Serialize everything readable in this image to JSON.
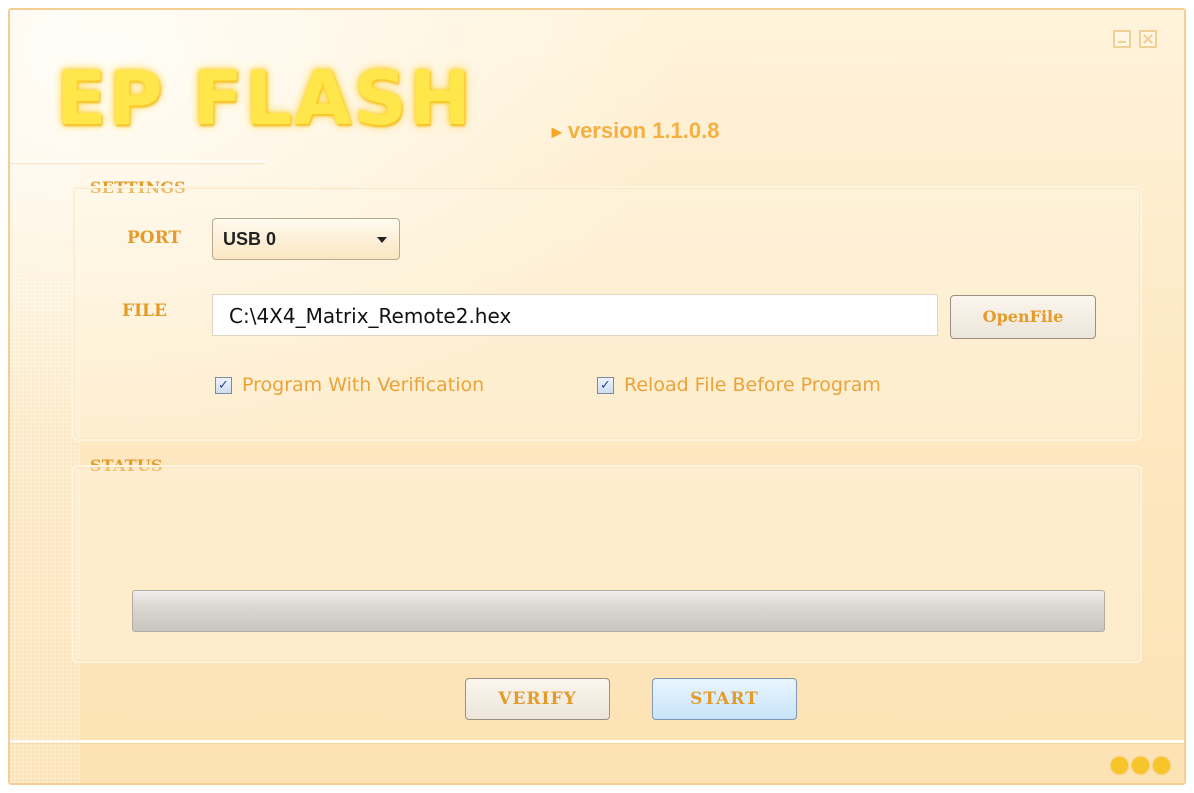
{
  "app": {
    "title": "EP FLASH",
    "version": "version 1.1.0.8",
    "version_arrow": "►"
  },
  "window_controls": {
    "minimize_icon": "minimize-icon",
    "close_icon": "close-icon"
  },
  "settings": {
    "label": "SETTINGS",
    "port": {
      "label": "PORT",
      "value": "USB 0"
    },
    "file": {
      "label": "FILE",
      "value": "C:\\4X4_Matrix_Remote2.hex",
      "open_button": "OpenFile"
    },
    "options": [
      {
        "label": "Program With Verification",
        "checked": true
      },
      {
        "label": "Reload File Before Program",
        "checked": true
      }
    ],
    "check_mark": "✓"
  },
  "status": {
    "label": "STATUS",
    "progress": 0
  },
  "actions": {
    "verify_label": "VERIFY",
    "start_label": "START"
  },
  "colors": {
    "accent": "#e39b2a",
    "logo": "#ffe64a",
    "background": "#fde9c4",
    "start_button": "#c8e4f9"
  }
}
